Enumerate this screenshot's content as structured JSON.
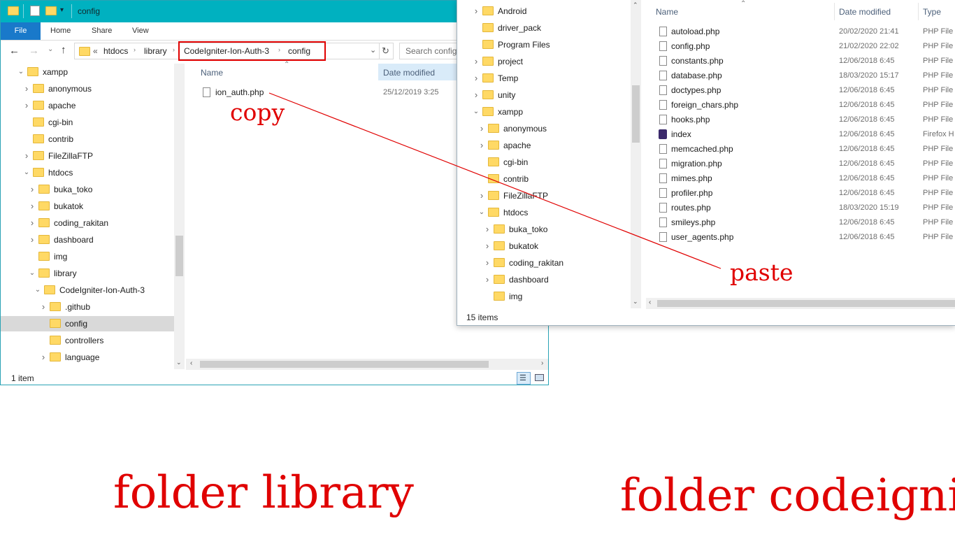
{
  "left_window": {
    "title": "config",
    "ribbon_tabs": [
      "File",
      "Home",
      "Share",
      "View"
    ],
    "breadcrumb": [
      "htdocs",
      "library",
      "CodeIgniter-Ion-Auth-3",
      "config"
    ],
    "breadcrumb_overflow": "«",
    "search_placeholder": "Search config",
    "tree": [
      {
        "label": "xampp",
        "expanded": true
      },
      {
        "label": "anonymous"
      },
      {
        "label": "apache"
      },
      {
        "label": "cgi-bin"
      },
      {
        "label": "contrib"
      },
      {
        "label": "FileZillaFTP"
      },
      {
        "label": "htdocs",
        "expanded": true
      },
      {
        "label": "buka_toko"
      },
      {
        "label": "bukatok"
      },
      {
        "label": "coding_rakitan"
      },
      {
        "label": "dashboard"
      },
      {
        "label": "img"
      },
      {
        "label": "library",
        "expanded": true
      },
      {
        "label": "CodeIgniter-Ion-Auth-3",
        "expanded": true
      },
      {
        "label": ".github"
      },
      {
        "label": "config",
        "selected": true
      },
      {
        "label": "controllers"
      },
      {
        "label": "language"
      }
    ],
    "columns": {
      "name": "Name",
      "date": "Date modified"
    },
    "files": [
      {
        "name": "ion_auth.php",
        "date": "25/12/2019 3:25"
      }
    ],
    "status": "1 item"
  },
  "right_window": {
    "tree": [
      {
        "label": "Android"
      },
      {
        "label": "driver_pack"
      },
      {
        "label": "Program Files"
      },
      {
        "label": "project"
      },
      {
        "label": "Temp"
      },
      {
        "label": "unity"
      },
      {
        "label": "xampp",
        "expanded": true
      },
      {
        "label": "anonymous"
      },
      {
        "label": "apache"
      },
      {
        "label": "cgi-bin"
      },
      {
        "label": "contrib"
      },
      {
        "label": "FileZillaFTP"
      },
      {
        "label": "htdocs",
        "expanded": true
      },
      {
        "label": "buka_toko"
      },
      {
        "label": "bukatok"
      },
      {
        "label": "coding_rakitan"
      },
      {
        "label": "dashboard"
      },
      {
        "label": "img"
      }
    ],
    "columns": {
      "name": "Name",
      "date": "Date modified",
      "type": "Type"
    },
    "files": [
      {
        "name": "autoload.php",
        "date": "20/02/2020 21:41",
        "type": "PHP File"
      },
      {
        "name": "config.php",
        "date": "21/02/2020 22:02",
        "type": "PHP File"
      },
      {
        "name": "constants.php",
        "date": "12/06/2018 6:45",
        "type": "PHP File"
      },
      {
        "name": "database.php",
        "date": "18/03/2020 15:17",
        "type": "PHP File"
      },
      {
        "name": "doctypes.php",
        "date": "12/06/2018 6:45",
        "type": "PHP File"
      },
      {
        "name": "foreign_chars.php",
        "date": "12/06/2018 6:45",
        "type": "PHP File"
      },
      {
        "name": "hooks.php",
        "date": "12/06/2018 6:45",
        "type": "PHP File"
      },
      {
        "name": "index",
        "date": "12/06/2018 6:45",
        "type": "Firefox H"
      },
      {
        "name": "memcached.php",
        "date": "12/06/2018 6:45",
        "type": "PHP File"
      },
      {
        "name": "migration.php",
        "date": "12/06/2018 6:45",
        "type": "PHP File"
      },
      {
        "name": "mimes.php",
        "date": "12/06/2018 6:45",
        "type": "PHP File"
      },
      {
        "name": "profiler.php",
        "date": "12/06/2018 6:45",
        "type": "PHP File"
      },
      {
        "name": "routes.php",
        "date": "18/03/2020 15:19",
        "type": "PHP File"
      },
      {
        "name": "smileys.php",
        "date": "12/06/2018 6:45",
        "type": "PHP File"
      },
      {
        "name": "user_agents.php",
        "date": "12/06/2018 6:45",
        "type": "PHP File"
      }
    ],
    "status": "15 items"
  },
  "annotations": {
    "copy": "copy",
    "paste": "paste",
    "left_caption": "folder library",
    "right_caption": "folder codeignit",
    "color": "#e00000"
  }
}
